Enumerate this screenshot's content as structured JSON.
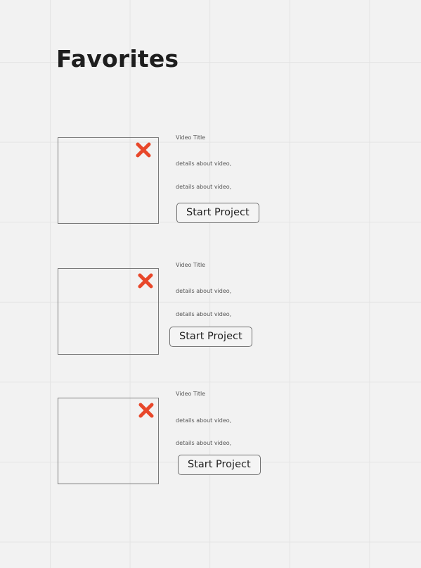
{
  "page": {
    "title": "Favorites"
  },
  "favorites": [
    {
      "video_title": "Video Title",
      "details": [
        "details about video,",
        "details about video,"
      ],
      "action_label": "Start Project"
    },
    {
      "video_title": "Video Title",
      "details": [
        "details about video,",
        "details about video,"
      ],
      "action_label": "Start Project"
    },
    {
      "video_title": "Video Title",
      "details": [
        "details about video,",
        "details about video,"
      ],
      "action_label": "Start Project"
    }
  ],
  "colors": {
    "background": "#f2f2f2",
    "grid_line": "#e4e4e4",
    "remove_icon": "#e8472a",
    "thumbnail_border": "#7a7a7a"
  },
  "icons": {
    "remove": "close-icon"
  }
}
